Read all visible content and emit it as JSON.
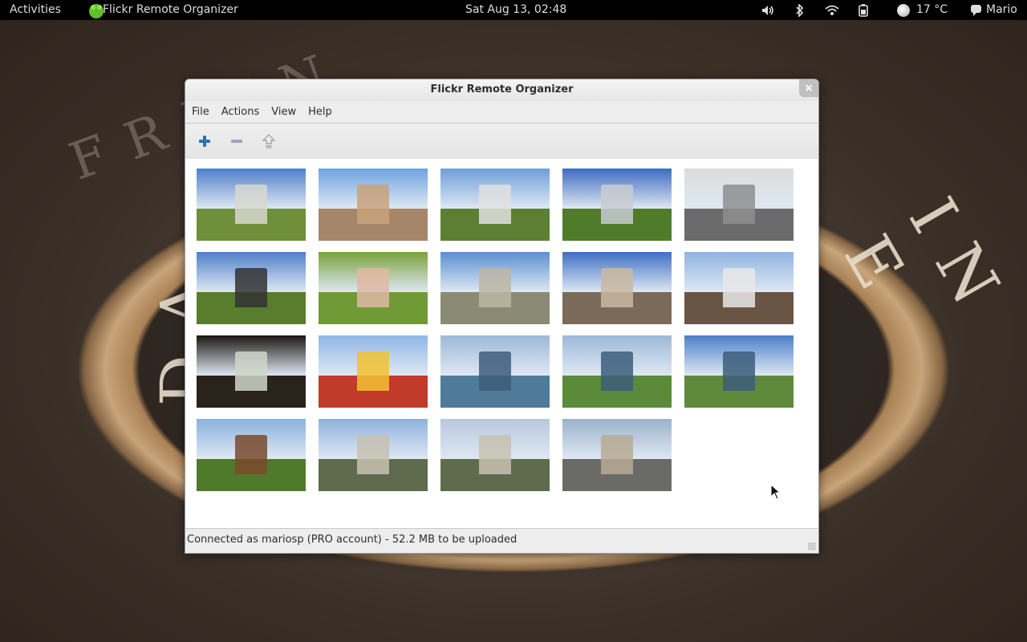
{
  "topbar": {
    "activities": "Activities",
    "app_name": "Flickr Remote Organizer",
    "clock": "Sat Aug 13, 02:48",
    "temperature": "17 °C",
    "user": "Mario"
  },
  "window": {
    "title": "Flickr Remote Organizer",
    "menu": [
      "File",
      "Actions",
      "View",
      "Help"
    ],
    "toolbar": {
      "add_icon": "plus-icon",
      "remove_icon": "minus-icon",
      "upload_icon": "upload-icon"
    },
    "status": "Connected as mariosp (PRO account) - 52.2 MB to be uploaded"
  },
  "photos": [
    {
      "sky": "#4f7fc9",
      "ground": "#6f8f3a",
      "accent": "#d8d8d0"
    },
    {
      "sky": "#6fa3df",
      "ground": "#a58669",
      "accent": "#c9a27c"
    },
    {
      "sky": "#6e9fd8",
      "ground": "#5d7f34",
      "accent": "#e0e0e0"
    },
    {
      "sky": "#3d6cc0",
      "ground": "#4f7b2b",
      "accent": "#c8ccd2"
    },
    {
      "sky": "#dcdcdc",
      "ground": "#6b6b6b",
      "accent": "#8e8e8e"
    },
    {
      "sky": "#4f7fc9",
      "ground": "#577d2d",
      "accent": "#333"
    },
    {
      "sky": "#7aa13d",
      "ground": "#6f9a35",
      "accent": "#e0b9a3"
    },
    {
      "sky": "#5c8fd0",
      "ground": "#8b8a74",
      "accent": "#bcb6a6"
    },
    {
      "sky": "#3e6fc4",
      "ground": "#7a6a59",
      "accent": "#c9b8a1"
    },
    {
      "sky": "#8fb3e0",
      "ground": "#6a5544",
      "accent": "#e7e7e7"
    },
    {
      "sky": "#1a1612",
      "ground": "#2a231c",
      "accent": "#cfd6c9"
    },
    {
      "sky": "#8fb6e6",
      "ground": "#c23a2a",
      "accent": "#f2c232"
    },
    {
      "sky": "#9db8d8",
      "ground": "#4f7a9a",
      "accent": "#3c5d7a"
    },
    {
      "sky": "#9db8d8",
      "ground": "#5a8a3a",
      "accent": "#3c5d7a"
    },
    {
      "sky": "#4e7fc9",
      "ground": "#5f8a3b",
      "accent": "#3c5d7a"
    },
    {
      "sky": "#8bb1de",
      "ground": "#4f7a2c",
      "accent": "#7a4a2c"
    },
    {
      "sky": "#8fb1dc",
      "ground": "#5e6b4c",
      "accent": "#c7c1b2"
    },
    {
      "sky": "#b7c8dc",
      "ground": "#5e6b4c",
      "accent": "#c7c1b2"
    },
    {
      "sky": "#9bb2c9",
      "ground": "#6a6a66",
      "accent": "#b7aa95"
    }
  ]
}
